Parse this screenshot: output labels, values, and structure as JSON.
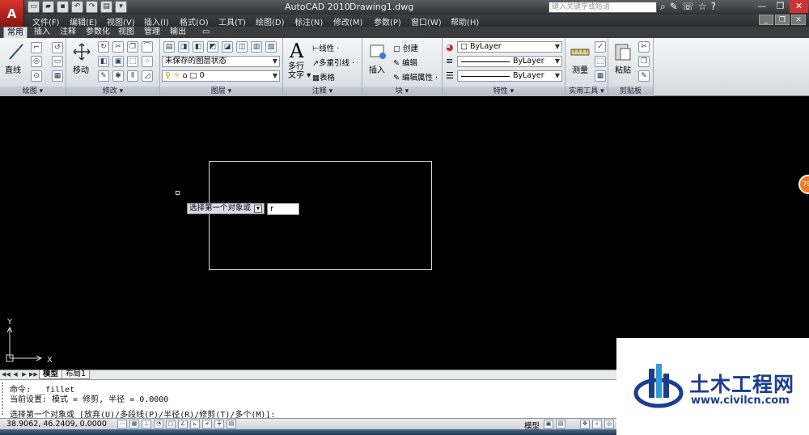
{
  "window": {
    "app_title": "AutoCAD 2010",
    "doc_title": "Drawing1.dwg",
    "search_placeholder": "键入关键字或短语",
    "logo_letter": "A",
    "controls": [
      "minimize-icon",
      "restore-icon",
      "close-icon"
    ]
  },
  "quick_access": [
    "new-icon",
    "open-icon",
    "save-icon",
    "undo-icon",
    "redo-icon",
    "plot-icon",
    "dropdown-icon"
  ],
  "menu": [
    "文件(F)",
    "编辑(E)",
    "视图(V)",
    "插入(I)",
    "格式(O)",
    "工具(T)",
    "绘图(D)",
    "标注(N)",
    "修改(M)",
    "参数(P)",
    "窗口(W)",
    "帮助(H)"
  ],
  "ribbon_tabs": {
    "items": [
      "常用",
      "插入",
      "注释",
      "参数化",
      "视图",
      "管理",
      "输出"
    ],
    "active": "常用"
  },
  "ribbon": {
    "draw": {
      "title": "绘图 ▾",
      "line_label": "直线"
    },
    "modify": {
      "title": "修改 ▾",
      "move_label": "移动"
    },
    "layers": {
      "title": "图层 ▾",
      "layer_state": "未保存的图层状态",
      "current_layer": "0"
    },
    "annotation": {
      "title": "注释 ▾",
      "mtext_label": "多行\n文字 ▾",
      "linear": "线性 ·",
      "mleader": "多重引线 ·",
      "table": "表格"
    },
    "block": {
      "title": "块 ▾",
      "insert_label": "插入",
      "create": "创建",
      "edit": "编辑",
      "edit_attr": "编辑属性 ·"
    },
    "properties": {
      "title": "特性 ▾",
      "color": "ByLayer",
      "linetype": "ByLayer",
      "lineweight": "ByLayer"
    },
    "utilities": {
      "title": "实用工具 ▾",
      "measure_label": "测量"
    },
    "clipboard": {
      "title": "剪贴板",
      "paste_label": "粘贴"
    }
  },
  "canvas": {
    "dynamic_prompt": "选择第一个对象或",
    "dynamic_input_value": "r",
    "ucs_x": "X",
    "ucs_y": "Y",
    "side_badge": "79"
  },
  "layout_tabs": {
    "items": [
      "模型",
      "布局1"
    ],
    "active": "模型"
  },
  "command_line": {
    "line1": "命令:  _fillet",
    "line2": "当前设置: 模式 = 修剪, 半径 = 0.0000",
    "line3": "选择第一个对象或 [放弃(U)/多段线(P)/半径(R)/修剪(T)/多个(M)]:"
  },
  "status_bar": {
    "coordinates": "38.9062,  46.2409,  0.0000",
    "space_label": "模型"
  },
  "watermark": {
    "name": "土木工程网",
    "url": "www.civilcn.com"
  }
}
